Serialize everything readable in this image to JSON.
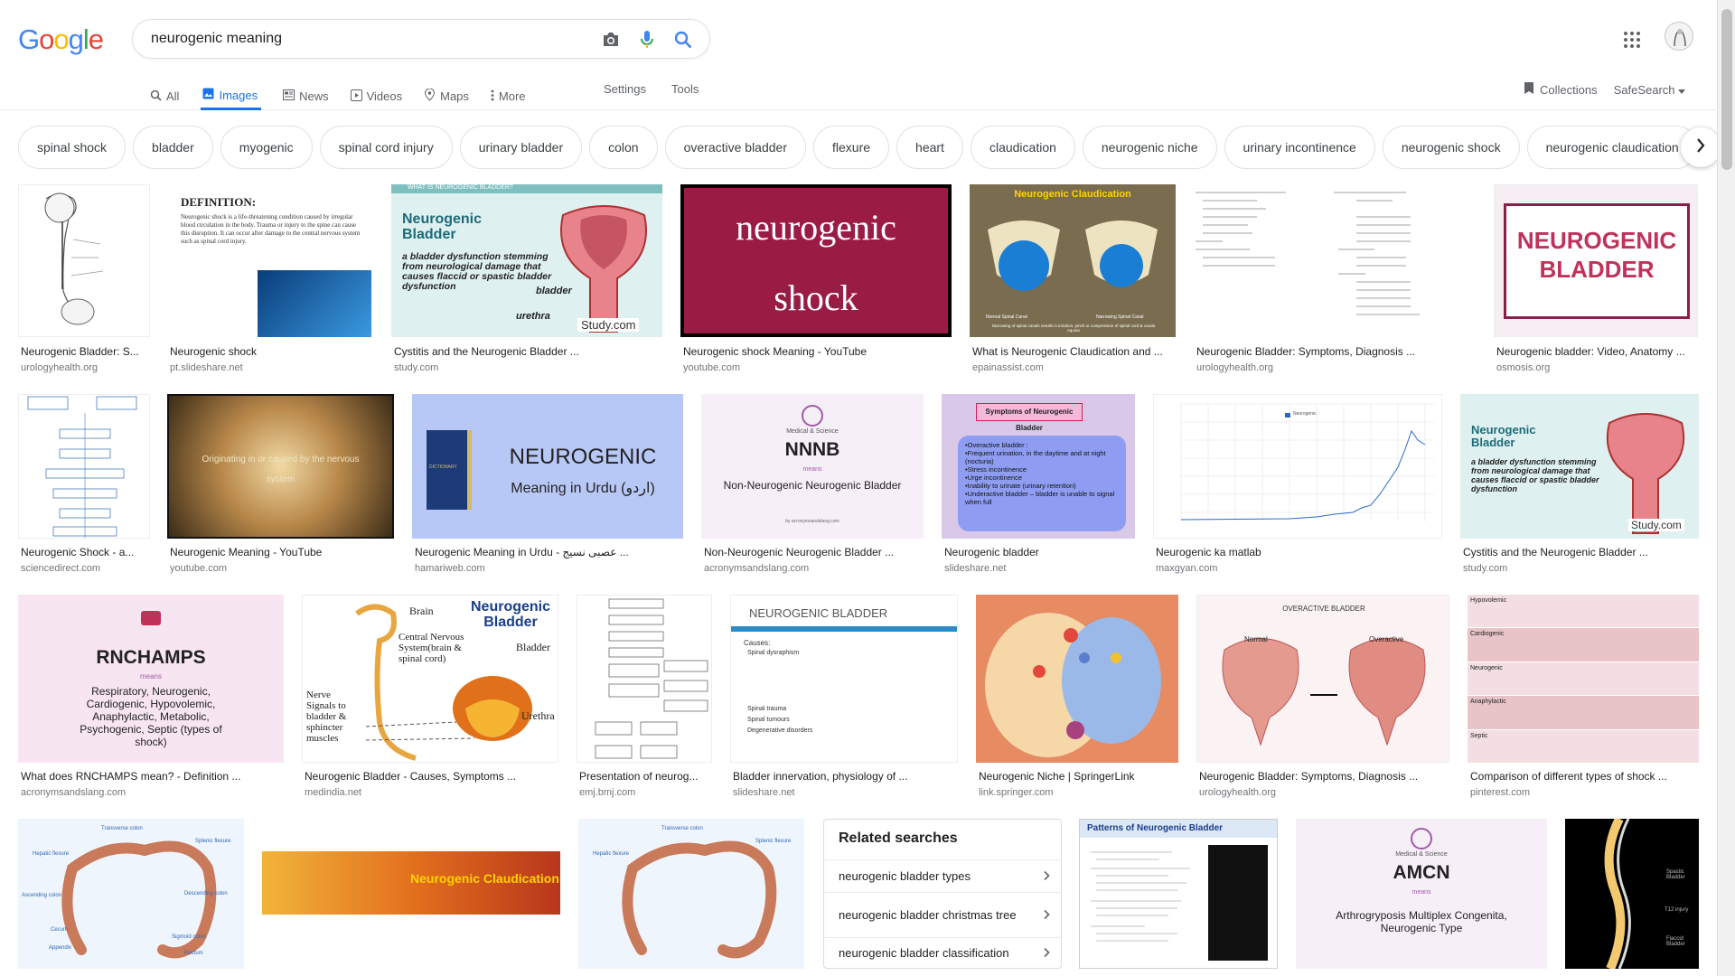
{
  "search": {
    "query": "neurogenic meaning"
  },
  "logo": {
    "letters": [
      "G",
      "o",
      "o",
      "g",
      "l",
      "e"
    ],
    "colors": [
      "#4285f4",
      "#ea4335",
      "#fbbc05",
      "#4285f4",
      "#34a853",
      "#ea4335"
    ]
  },
  "tabs": [
    {
      "label": "All",
      "icon": "search-icon",
      "active": false
    },
    {
      "label": "Images",
      "icon": "image-icon",
      "active": true
    },
    {
      "label": "News",
      "icon": "news-icon",
      "active": false
    },
    {
      "label": "Videos",
      "icon": "video-icon",
      "active": false
    },
    {
      "label": "Maps",
      "icon": "map-pin-icon",
      "active": false
    },
    {
      "label": "More",
      "icon": "more-vert-icon",
      "active": false
    }
  ],
  "tools_links": [
    "Settings",
    "Tools"
  ],
  "header_right": {
    "collections": "Collections",
    "safesearch": "SafeSearch"
  },
  "chips": [
    "spinal shock",
    "bladder",
    "myogenic",
    "spinal cord injury",
    "urinary bladder",
    "colon",
    "overactive bladder",
    "flexure",
    "heart",
    "claudication",
    "neurogenic niche",
    "urinary incontinence",
    "neurogenic shock",
    "neurogenic claudication"
  ],
  "results": {
    "row1": [
      {
        "title": "Neurogenic Bladder: S...",
        "site": "urologyhealth.org"
      },
      {
        "title": "Neurogenic shock",
        "site": "pt.slideshare.net"
      },
      {
        "title": "Cystitis and the Neurogenic Bladder ...",
        "site": "study.com"
      },
      {
        "title": "Neurogenic shock Meaning - YouTube",
        "site": "youtube.com"
      },
      {
        "title": "What is Neurogenic Claudication and ...",
        "site": "epainassist.com"
      },
      {
        "title": "Neurogenic Bladder: Symptoms, Diagnosis ...",
        "site": "urologyhealth.org"
      },
      {
        "title": "Neurogenic bladder: Video, Anatomy ...",
        "site": "osmosis.org"
      }
    ],
    "row2": [
      {
        "title": "Neurogenic Shock - a...",
        "site": "sciencedirect.com"
      },
      {
        "title": "Neurogenic Meaning - YouTube",
        "site": "youtube.com"
      },
      {
        "title": "Neurogenic Meaning in Urdu - عصبی نسیج ...",
        "site": "hamariweb.com"
      },
      {
        "title": "Non-Neurogenic Neurogenic Bladder ...",
        "site": "acronymsandslang.com"
      },
      {
        "title": "Neurogenic bladder",
        "site": "slideshare.net"
      },
      {
        "title": "Neurogenic ka matlab",
        "site": "maxgyan.com"
      },
      {
        "title": "Cystitis and the Neurogenic Bladder ...",
        "site": "study.com"
      }
    ],
    "row3": [
      {
        "title": "What does RNCHAMPS mean? - Definition ...",
        "site": "acronymsandslang.com"
      },
      {
        "title": "Neurogenic Bladder - Causes, Symptoms ...",
        "site": "medindia.net"
      },
      {
        "title": "Presentation of neurog...",
        "site": "emj.bmj.com"
      },
      {
        "title": "Bladder innervation, physiology of ...",
        "site": "slideshare.net"
      },
      {
        "title": "Neurogenic Niche | SpringerLink",
        "site": "link.springer.com"
      },
      {
        "title": "Neurogenic Bladder: Symptoms, Diagnosis ...",
        "site": "urologyhealth.org"
      },
      {
        "title": "Comparison of different types of shock ...",
        "site": "pinterest.com"
      }
    ]
  },
  "thumb_text": {
    "definition": {
      "heading": "DEFINITION:",
      "body": "Neurogenic shock is a life-threatening condition caused by irregular blood circulation in the body. Trauma or injury to the spine can cause this disruption. It can occur after damage to the central nervous system such as spinal cord injury."
    },
    "study": {
      "banner": "WHAT IS NEUROGENIC BLADDER?",
      "title": "Neurogenic Bladder",
      "body": "a bladder dysfunction stemming from neurological damage that causes flaccid or spastic bladder dysfunction",
      "bladder": "bladder",
      "urethra": "urethra",
      "brand": "Study.com"
    },
    "shock": {
      "line1": "neurogenic",
      "line2": "shock"
    },
    "claudication": {
      "title": "Neurogenic Claudication",
      "left": "Normal Spinal Canal",
      "right": "Narrowing Spinal Canal",
      "caption": "Narrowing of spinal canals results in irritation, pinch or compression of spinal cord & cauda equina"
    },
    "osmosis": {
      "text": "NEUROGENIC BLADDER"
    },
    "yt2": {
      "text": "Originating in or caused by the nervous system"
    },
    "urdu": {
      "line1": "NEUROGENIC",
      "line2": "Meaning in Urdu (اردو)",
      "book": "DICTIONARY"
    },
    "nnnb": {
      "small": "Medical & Science",
      "acr": "NNNB",
      "means": "means",
      "full": "Non-Neurogenic Neurogenic Bladder",
      "by": "by acronymsandslang.com"
    },
    "symptoms": {
      "title": "Symptoms of Neurogenic Bladder",
      "items": [
        "•Overactive bladder :",
        "•Frequent urination, in the daytime and at night (nocturia)",
        "•Stress incontinence",
        "•Urge incontinence",
        "•Inability to urinate (urinary retention)",
        "•Underactive bladder – bladder is unable to signal when full"
      ]
    },
    "rnchamps": {
      "acr": "RNCHAMPS",
      "means": "means",
      "full": "Respiratory, Neurogenic, Cardiogenic, Hypovolemic, Anaphylactic, Metabolic, Psychogenic, Septic (types of shock)"
    },
    "medindia": {
      "title": "Neurogenic Bladder",
      "brain": "Brain",
      "cns": "Central Nervous System(brain & spinal cord)",
      "nerve": "Nerve Signals to bladder & sphincter muscles",
      "bladder": "Bladder",
      "urethra": "Urethra"
    },
    "innervation": {
      "title": "NEUROGENIC BLADDER",
      "causes": "Causes:",
      "items": [
        "Spinal dysraphism",
        "Spinal trauma",
        "Spinal tumours",
        "Degenerative disorders"
      ]
    },
    "overactive": {
      "title": "OVERACTIVE BLADDER",
      "left": "Normal",
      "right": "Overactive"
    },
    "shocktable": {
      "rows": [
        "Hypovolemic",
        "Cardiogenic",
        "Neurogenic",
        "Anaphylactic",
        "Septic"
      ]
    },
    "colon": {
      "labels": [
        "Transverse colon",
        "Hepatic flexure",
        "Splenic flexure",
        "Ascending colon",
        "Descending colon",
        "Cecum",
        "Sigmoid colon",
        "Appendix",
        "Rectum"
      ]
    },
    "claud2": {
      "title": "Neurogenic Claudication"
    },
    "patterns": {
      "title": "Patterns of Neurogenic Bladder"
    },
    "amcn": {
      "small": "Medical & Science",
      "acr": "AMCN",
      "means": "means",
      "full": "Arthrogryposis Multiplex Congenita, Neurogenic Type"
    },
    "spine": {
      "labels": [
        "Spastic Bladder",
        "T12 injury",
        "Flaccid Bladder"
      ]
    }
  },
  "related": {
    "title": "Related searches",
    "items": [
      "neurogenic bladder types",
      "neurogenic bladder christmas tree",
      "neurogenic bladder classification"
    ]
  },
  "chart_thumb": {
    "legend": "Neurogenic"
  }
}
